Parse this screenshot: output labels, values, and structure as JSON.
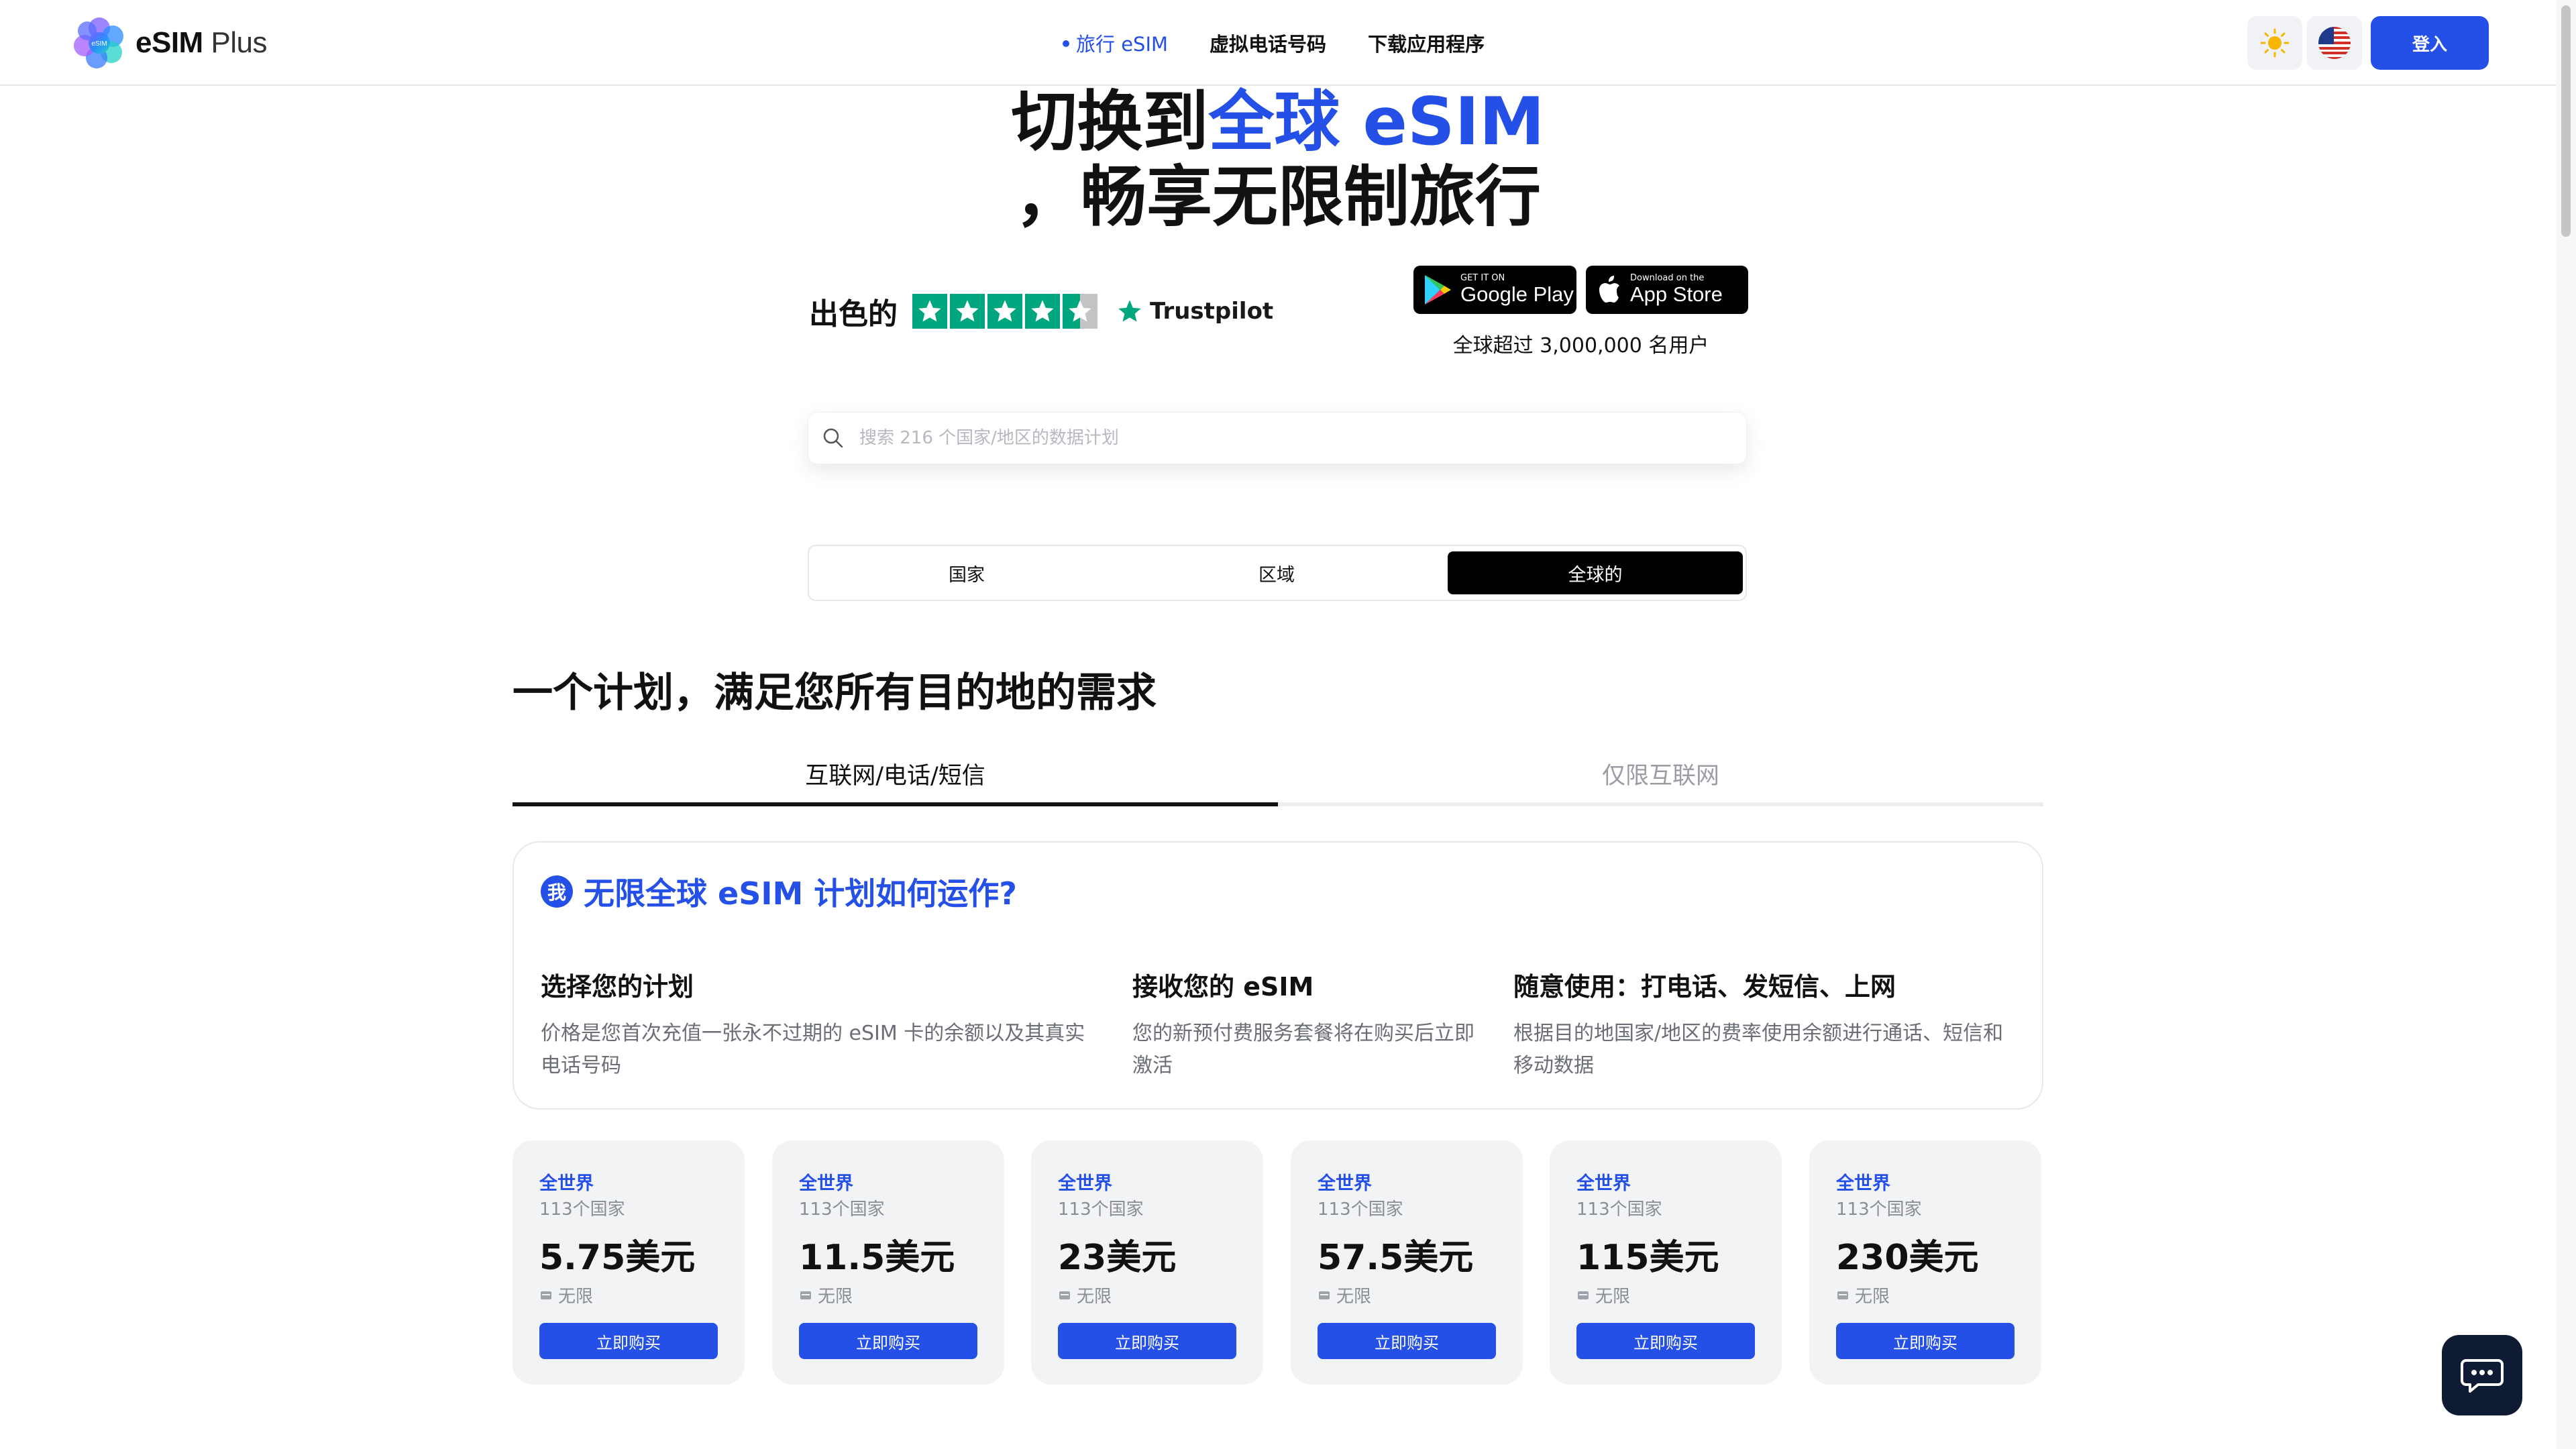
{
  "header": {
    "logo_bold": "eSIM",
    "logo_light": " Plus",
    "logo_mark_text": "eSIM",
    "nav": [
      {
        "label": "旅行 eSIM"
      },
      {
        "label": "虚拟电话号码"
      },
      {
        "label": "下载应用程序"
      }
    ],
    "login_label": "登入"
  },
  "hero": {
    "line1_a": "切换到",
    "line1_b": "全球 eSIM",
    "line2": "，畅享无限制旅行",
    "rating_word": "出色的",
    "trustpilot": "Trustpilot",
    "google_small": "GET IT ON",
    "google_big": "Google Play",
    "apple_small": "Download on the",
    "apple_big": "App Store",
    "users": "全球超过 3,000,000 名用户"
  },
  "search": {
    "placeholder": "搜索 216 个国家/地区的数据计划"
  },
  "segment": {
    "items": [
      {
        "label": "国家"
      },
      {
        "label": "区域"
      },
      {
        "label": "全球的"
      }
    ]
  },
  "section": {
    "title": "一个计划，满足您所有目的地的需求"
  },
  "tabs": [
    {
      "label": "互联网/电话/短信"
    },
    {
      "label": "仅限互联网"
    }
  ],
  "how": {
    "badge": "我",
    "title": "无限全球 eSIM 计划如何运作?",
    "steps": [
      {
        "title": "选择您的计划",
        "desc": "价格是您首次充值一张永不过期的 eSIM 卡的余额以及其真实电话号码"
      },
      {
        "title": "接收您的 eSIM",
        "desc": "您的新预付费服务套餐将在购买后立即激活"
      },
      {
        "title": "随意使用：打电话、发短信、上网",
        "desc": "根据目的地国家/地区的费率使用余额进行通话、短信和移动数据"
      }
    ]
  },
  "plans": [
    {
      "region": "全世界",
      "count": "113个国家",
      "price": "5.75美元",
      "limit": "无限",
      "buy": "立即购买"
    },
    {
      "region": "全世界",
      "count": "113个国家",
      "price": "11.5美元",
      "limit": "无限",
      "buy": "立即购买"
    },
    {
      "region": "全世界",
      "count": "113个国家",
      "price": "23美元",
      "limit": "无限",
      "buy": "立即购买"
    },
    {
      "region": "全世界",
      "count": "113个国家",
      "price": "57.5美元",
      "limit": "无限",
      "buy": "立即购买"
    },
    {
      "region": "全世界",
      "count": "113个国家",
      "price": "115美元",
      "limit": "无限",
      "buy": "立即购买"
    },
    {
      "region": "全世界",
      "count": "113个国家",
      "price": "230美元",
      "limit": "无限",
      "buy": "立即购买"
    }
  ],
  "colors": {
    "accent": "#2450e8",
    "trustpilot_green": "#00a67d",
    "chat_bg": "#0f1a33"
  },
  "icons": {
    "theme": "sun-icon",
    "language": "us-flag-icon",
    "search": "search-icon",
    "chat": "chat-icon"
  }
}
